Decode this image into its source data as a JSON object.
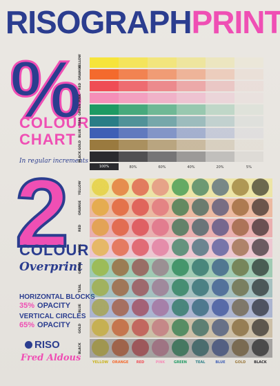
{
  "title": {
    "part1": "RISOGRAPH",
    "part2": "PRINTING",
    "color1": "#2b3d8f",
    "color2": "#ef4fb4"
  },
  "section1": {
    "big_symbol": "%",
    "heading_line1": "COLOUR",
    "heading_line2": "CHART",
    "subtitle": "In regular increments"
  },
  "section2": {
    "big_number": "2",
    "heading_line1": "COLOUR",
    "heading_line2": "Overprint"
  },
  "notes": {
    "horizontal_label": "HORIZONTAL BLOCKS",
    "horizontal_percent": "35%",
    "horizontal_opacity": "OPACITY",
    "vertical_label": "VERTICAL CIRCLES",
    "vertical_percent": "65%",
    "vertical_opacity": "OPACITY"
  },
  "logos": {
    "riso": "RISO",
    "fred": "Fred Aldous"
  },
  "inks": [
    {
      "name": "YELLOW",
      "color": "#f6e43a"
    },
    {
      "name": "ORANGE",
      "color": "#f46a2d"
    },
    {
      "name": "RED",
      "color": "#ef4d55"
    },
    {
      "name": "PINK",
      "color": "#f58fb8"
    },
    {
      "name": "GREEN",
      "color": "#1e9a63"
    },
    {
      "name": "TEAL",
      "color": "#2a7d86"
    },
    {
      "name": "BLUE",
      "color": "#3f5fb5"
    },
    {
      "name": "GOLD",
      "color": "#9a7a3f"
    },
    {
      "name": "BLACK",
      "color": "#2a2a2e"
    }
  ],
  "tints": {
    "labels": [
      "100%",
      "80%",
      "60%",
      "40%",
      "20%",
      "5%"
    ],
    "values": [
      1.0,
      0.8,
      0.6,
      0.4,
      0.2,
      0.05
    ]
  },
  "overprint": {
    "block_opacity": 0.35,
    "circle_opacity": 0.65
  }
}
